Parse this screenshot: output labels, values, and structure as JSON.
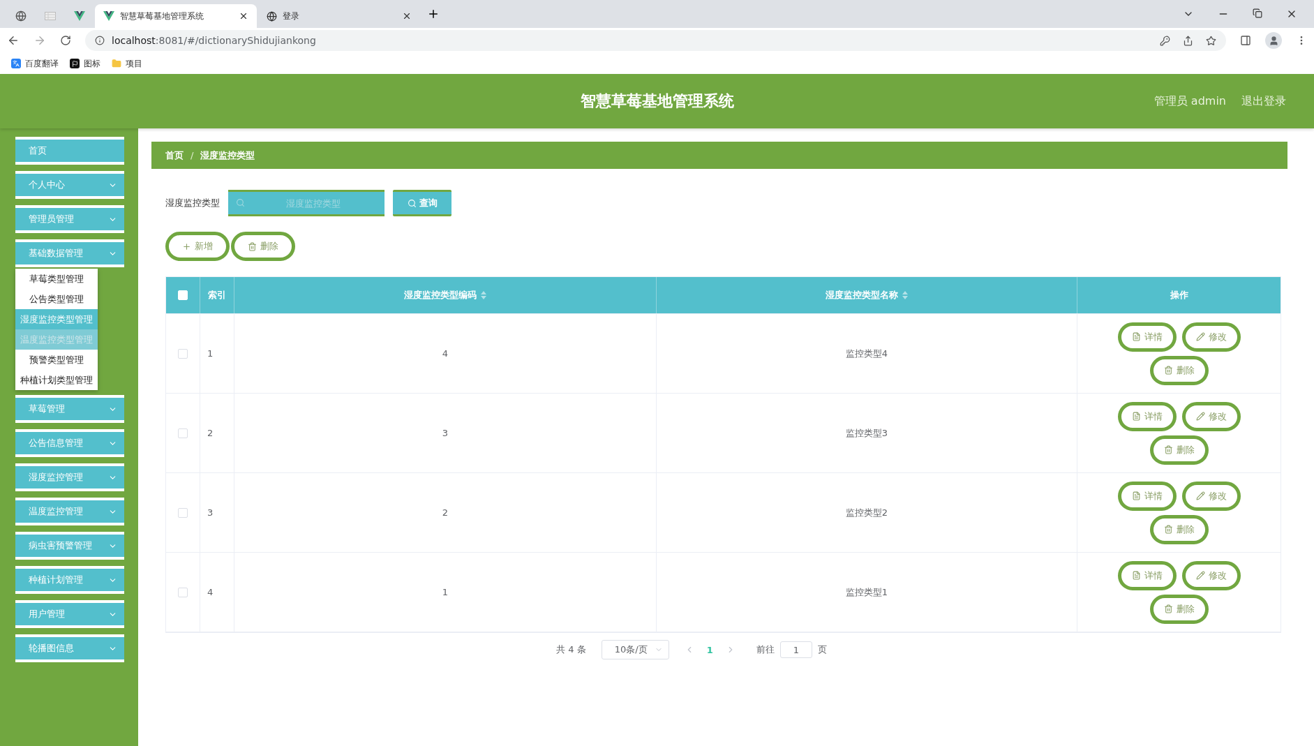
{
  "browser": {
    "tabs": [
      {
        "label": "智慧草莓基地管理系统",
        "selected": true,
        "kind": "vue"
      },
      {
        "label": "登录",
        "selected": false,
        "kind": "globe"
      }
    ],
    "address_host": "localhost",
    "address_path": ":8081/#/dictionaryShidujiankong",
    "bookmarks": [
      {
        "label": "百度翻译",
        "kind": "translate"
      },
      {
        "label": "图标",
        "kind": "flag"
      },
      {
        "label": "项目",
        "kind": "folder"
      }
    ]
  },
  "header": {
    "title": "智慧草莓基地管理系统",
    "user": "管理员 admin",
    "logout": "退出登录"
  },
  "sidebar": {
    "items": [
      {
        "label": "首页",
        "kind": "link"
      },
      {
        "label": "个人中心",
        "kind": "submenu"
      },
      {
        "label": "管理员管理",
        "kind": "submenu"
      },
      {
        "label": "基础数据管理",
        "kind": "submenu",
        "children": [
          {
            "label": "草莓类型管理",
            "selected": false,
            "hovered": false
          },
          {
            "label": "公告类型管理",
            "selected": false,
            "hovered": false
          },
          {
            "label": "湿度监控类型管理",
            "selected": true,
            "hovered": false
          },
          {
            "label": "温度监控类型管理",
            "selected": false,
            "hovered": true
          },
          {
            "label": "预警类型管理",
            "selected": false,
            "hovered": false
          },
          {
            "label": "种植计划类型管理",
            "selected": false,
            "hovered": false
          }
        ]
      },
      {
        "label": "草莓管理",
        "kind": "submenu"
      },
      {
        "label": "公告信息管理",
        "kind": "submenu"
      },
      {
        "label": "湿度监控管理",
        "kind": "submenu"
      },
      {
        "label": "温度监控管理",
        "kind": "submenu"
      },
      {
        "label": "病虫害预警管理",
        "kind": "submenu"
      },
      {
        "label": "种植计划管理",
        "kind": "submenu"
      },
      {
        "label": "用户管理",
        "kind": "submenu"
      },
      {
        "label": "轮播图信息",
        "kind": "submenu"
      }
    ]
  },
  "breadcrumb": {
    "items": [
      "首页",
      "湿度监控类型"
    ],
    "separator": "/"
  },
  "search": {
    "label": "湿度监控类型",
    "placeholder": "湿度监控类型",
    "button": "查询"
  },
  "actions": [
    {
      "kind": "add",
      "label": "新增"
    },
    {
      "kind": "delete",
      "label": "删除"
    }
  ],
  "table": {
    "header_checked": false,
    "columns": [
      {
        "label": "索引",
        "sortable": false
      },
      {
        "label": "湿度监控类型编码",
        "sortable": true
      },
      {
        "label": "湿度监控类型名称",
        "sortable": true
      },
      {
        "label": "操作",
        "sortable": false
      }
    ],
    "rows": [
      {
        "checked": false,
        "index": "1",
        "code": "4",
        "name": "监控类型4",
        "actions": [
          {
            "kind": "detail",
            "label": "详情"
          },
          {
            "kind": "edit",
            "label": "修改"
          },
          {
            "kind": "delete",
            "label": "删除"
          }
        ]
      },
      {
        "checked": false,
        "index": "2",
        "code": "3",
        "name": "监控类型3",
        "actions": [
          {
            "kind": "detail",
            "label": "详情"
          },
          {
            "kind": "edit",
            "label": "修改"
          },
          {
            "kind": "delete",
            "label": "删除"
          }
        ]
      },
      {
        "checked": false,
        "index": "3",
        "code": "2",
        "name": "监控类型2",
        "actions": [
          {
            "kind": "detail",
            "label": "详情"
          },
          {
            "kind": "edit",
            "label": "修改"
          },
          {
            "kind": "delete",
            "label": "删除"
          }
        ]
      },
      {
        "checked": false,
        "index": "4",
        "code": "1",
        "name": "监控类型1",
        "actions": [
          {
            "kind": "detail",
            "label": "详情"
          },
          {
            "kind": "edit",
            "label": "修改"
          },
          {
            "kind": "delete",
            "label": "删除"
          }
        ]
      }
    ]
  },
  "pagination": {
    "total": "共 4 条",
    "page_size": "10条/页",
    "pages": [
      {
        "label": "1",
        "selected": true
      }
    ],
    "goto_label": "前往",
    "goto_value": "1",
    "page_suffix": "页"
  }
}
